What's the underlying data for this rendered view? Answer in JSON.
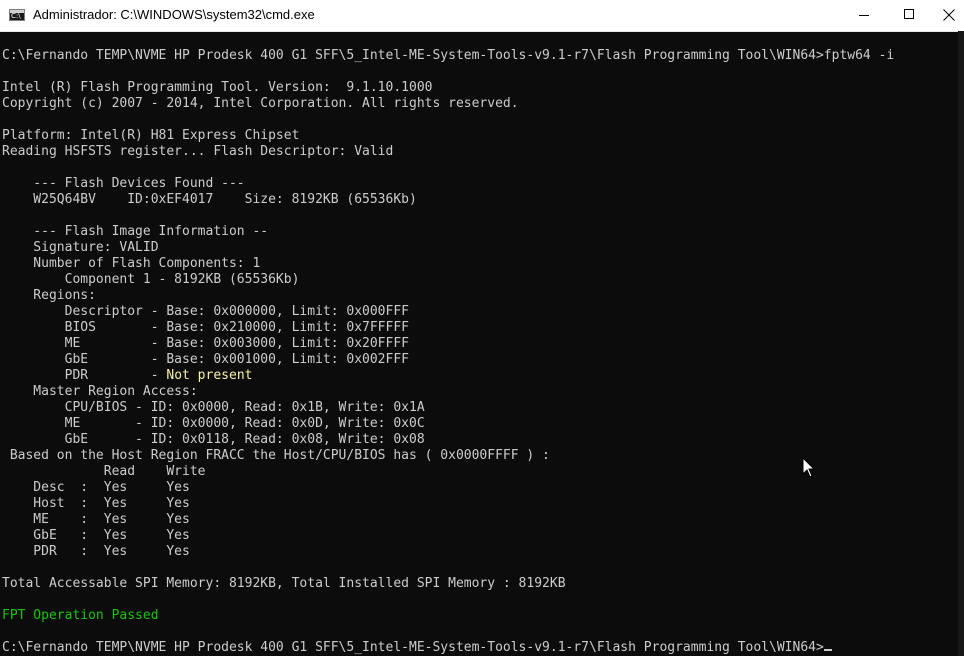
{
  "window": {
    "title": "Administrador: C:\\WINDOWS\\system32\\cmd.exe"
  },
  "console": {
    "prompt_cmd": "C:\\Fernando TEMP\\NVME HP Prodesk 400 G1 SFF\\5_Intel-ME-System-Tools-v9.1-r7\\Flash Programming Tool\\WIN64>fptw64 -i",
    "version": "Intel (R) Flash Programming Tool. Version:  9.1.10.1000",
    "copyright": "Copyright (c) 2007 - 2014, Intel Corporation. All rights reserved.",
    "platform": "Platform: Intel(R) H81 Express Chipset",
    "hsfsts": "Reading HSFSTS register... Flash Descriptor: Valid",
    "devices_header": "    --- Flash Devices Found ---",
    "device": "    W25Q64BV    ID:0xEF4017    Size: 8192KB (65536Kb)",
    "image_header": "    --- Flash Image Information --",
    "signature": "    Signature: VALID",
    "num_components": "    Number of Flash Components: 1",
    "component1": "        Component 1 - 8192KB (65536Kb)",
    "regions": "    Regions:",
    "region_descriptor": "        Descriptor - Base: 0x000000, Limit: 0x000FFF",
    "region_bios": "        BIOS       - Base: 0x210000, Limit: 0x7FFFFF",
    "region_me": "        ME         - Base: 0x003000, Limit: 0x20FFFF",
    "region_gbe": "        GbE        - Base: 0x001000, Limit: 0x002FFF",
    "region_pdr_prefix": "        PDR        - ",
    "region_pdr_status": "Not present",
    "master_access": "    Master Region Access:",
    "master_cpu": "        CPU/BIOS - ID: 0x0000, Read: 0x1B, Write: 0x1A",
    "master_me": "        ME       - ID: 0x0000, Read: 0x0D, Write: 0x0C",
    "master_gbe": "        GbE      - ID: 0x0118, Read: 0x08, Write: 0x08",
    "fracc": " Based on the Host Region FRACC the Host/CPU/BIOS has ( 0x0000FFFF ) :",
    "table_header": "             Read    Write",
    "row_desc": "    Desc  :  Yes     Yes",
    "row_host": "    Host  :  Yes     Yes",
    "row_me": "    ME    :  Yes     Yes",
    "row_gbe": "    GbE   :  Yes     Yes",
    "row_pdr": "    PDR   :  Yes     Yes",
    "total_memory": "Total Accessable SPI Memory: 8192KB, Total Installed SPI Memory : 8192KB",
    "passed": "FPT Operation Passed",
    "prompt_end": "C:\\Fernando TEMP\\NVME HP Prodesk 400 G1 SFF\\5_Intel-ME-System-Tools-v9.1-r7\\Flash Programming Tool\\WIN64>"
  },
  "colors": {
    "background": "#0c0c0c",
    "text": "#cccccc",
    "warning": "#f9f1a5",
    "success": "#16c60c"
  },
  "icons": [
    "cmd-app-icon",
    "minimize-icon",
    "maximize-icon",
    "close-icon",
    "mouse-pointer-icon"
  ]
}
